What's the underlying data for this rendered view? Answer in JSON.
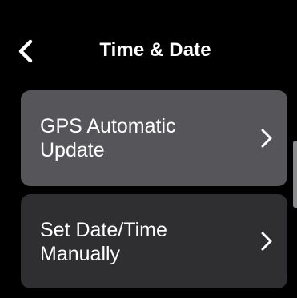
{
  "header": {
    "title": "Time & Date",
    "back_icon": "chevron-left-icon"
  },
  "menu": {
    "items": [
      {
        "label": "GPS Automatic Update",
        "icon": "chevron-right-icon",
        "selected": true
      },
      {
        "label": "Set Date/Time Manually",
        "icon": "chevron-right-icon",
        "selected": false
      }
    ]
  },
  "colors": {
    "background": "#000000",
    "text": "#ffffff",
    "selected_item": "#56565a",
    "item": "#2f2f31",
    "scrollbar": "#8a8a8c"
  }
}
